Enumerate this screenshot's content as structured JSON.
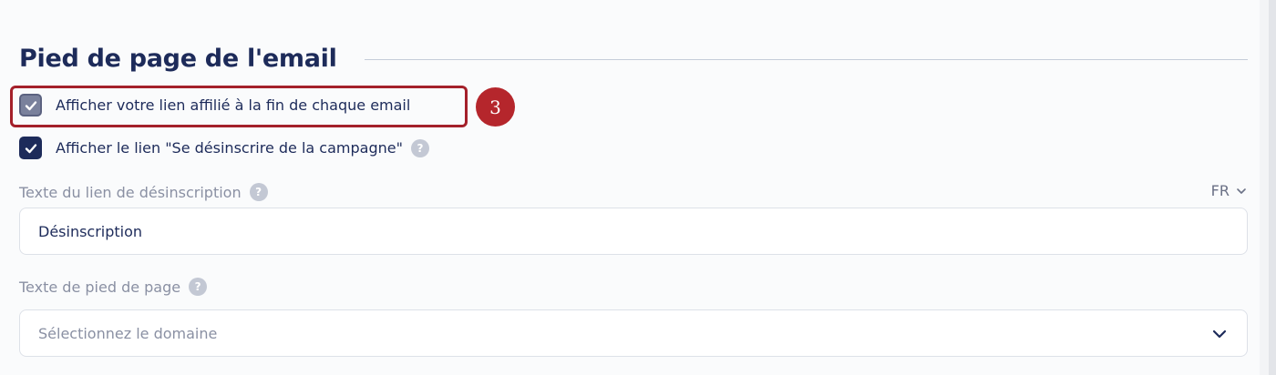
{
  "section": {
    "title": "Pied de page de l'email"
  },
  "options": {
    "affiliate_link_label": "Afficher votre lien affilié à la fin de chaque email",
    "affiliate_link_checked": true,
    "unsubscribe_link_label": "Afficher le lien \"Se désinscrire de la campagne\"",
    "unsubscribe_link_checked": true
  },
  "annotation": {
    "step_number": "3",
    "highlight_color": "#a4202a"
  },
  "help_icon_glyph": "?",
  "unsubscribe_text": {
    "label": "Texte du lien de désinscription",
    "language": "FR",
    "value": "Désinscription"
  },
  "footer_text": {
    "label": "Texte de pied de page",
    "placeholder": "Sélectionnez le domaine"
  },
  "colors": {
    "primary_navy": "#1d2b5a",
    "muted_checkbox": "#7a819c",
    "badge_red": "#b5262c"
  }
}
